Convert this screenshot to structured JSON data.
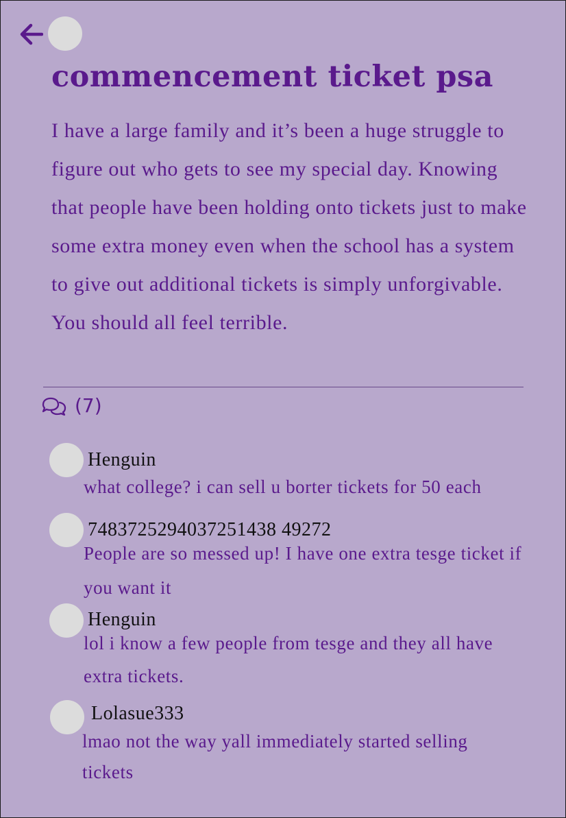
{
  "post": {
    "title": "commencement ticket psa",
    "body": "I have a large family and it’s been a huge struggle to figure out who gets to see my special day. Knowing that people have been holding onto tickets just to make some extra money even when the school has a system to give out additional tickets is simply unforgivable. You should all feel terrible.",
    "comment_count": "(7)"
  },
  "colors": {
    "background": "#b8a8cc",
    "accent": "#5a1a8c",
    "avatar": "#dcdcdc"
  },
  "icons": {
    "back": "arrow-left-icon",
    "comments": "chat-bubbles-icon"
  },
  "comments": [
    {
      "name": "Henguin",
      "text": "what college? i can sell u borter tickets for 50 each"
    },
    {
      "name": "7483725294037251438 49272",
      "text": "People are so messed up! I have one extra tesge ticket if you want it"
    },
    {
      "name": "Henguin",
      "text": "lol i know a few people from tesge and they all have extra tickets."
    },
    {
      "name": "Lolasue333",
      "text": "lmao not the way yall immediately started selling tickets"
    }
  ]
}
